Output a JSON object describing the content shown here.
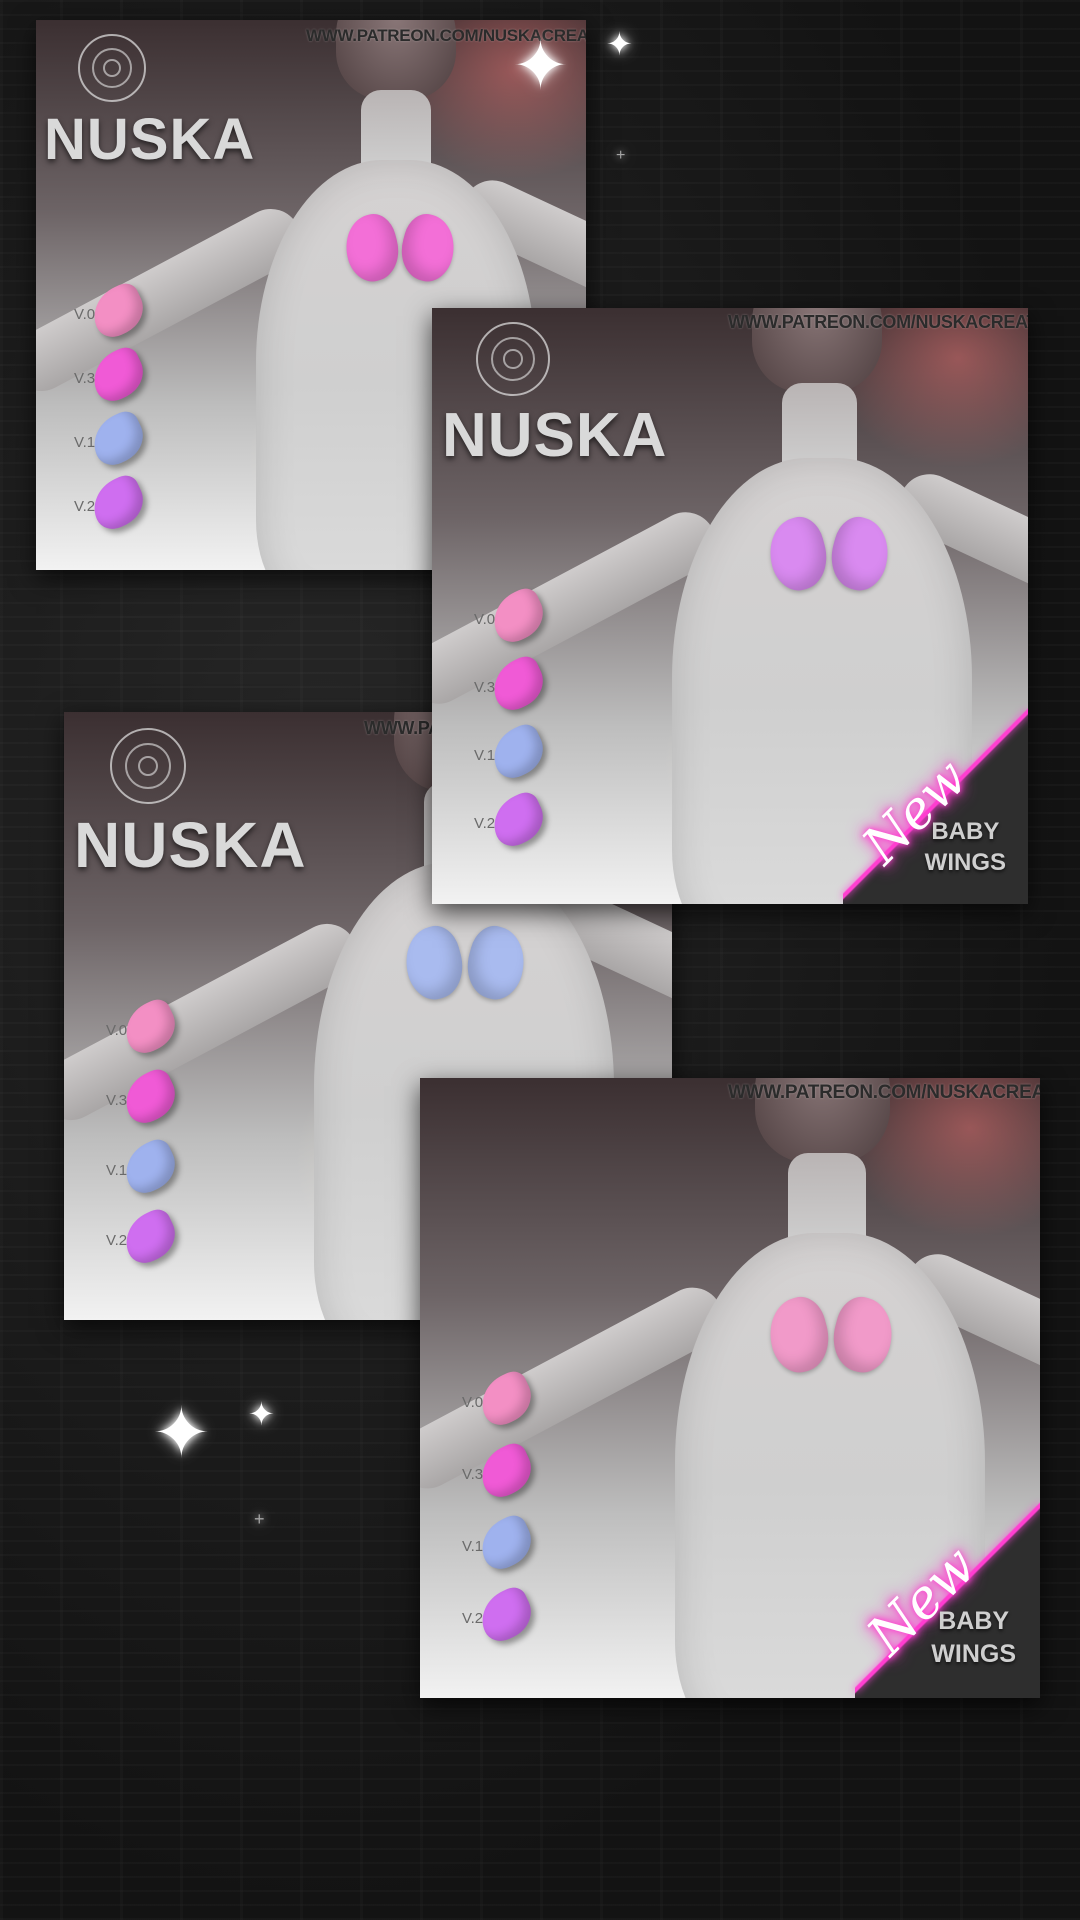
{
  "brand": "NUSKA",
  "url": "WWW.PATREON.COM/NUSKACREATIONS",
  "badge": "New",
  "product": {
    "line1": "BABY",
    "line2": "WINGS"
  },
  "variants": [
    {
      "label": "V.0",
      "color": "#f38fc4"
    },
    {
      "label": "V.3",
      "color": "#f05ad6"
    },
    {
      "label": "V.1",
      "color": "#9fb2ee"
    },
    {
      "label": "V.2",
      "color": "#cf6ef0"
    }
  ],
  "cards": [
    {
      "wing_color": "#f36fd7"
    },
    {
      "wing_color": "#d98af0"
    },
    {
      "wing_color": "#a9bbef"
    },
    {
      "wing_color": "#f19ac9"
    }
  ],
  "accent_color": "#ff3fd0"
}
